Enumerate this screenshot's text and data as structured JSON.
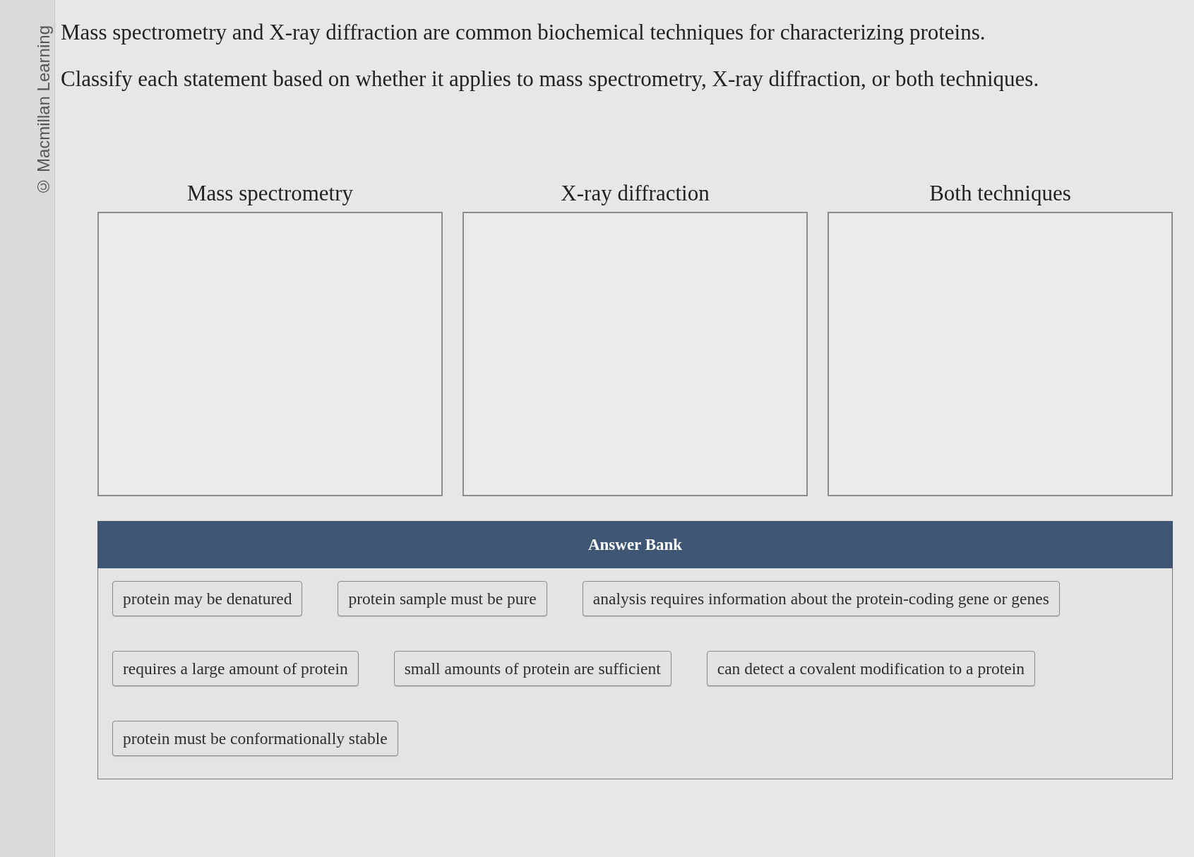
{
  "copyright": "© Macmillan Learning",
  "instructions": [
    "Mass spectrometry and X-ray diffraction are common biochemical techniques for characterizing proteins.",
    "Classify each statement based on whether it applies to mass spectrometry, X-ray diffraction, or both techniques."
  ],
  "categories": [
    {
      "label": "Mass spectrometry"
    },
    {
      "label": "X-ray diffraction"
    },
    {
      "label": "Both techniques"
    }
  ],
  "answer_bank": {
    "title": "Answer Bank",
    "items": [
      "protein may be denatured",
      "protein sample must be pure",
      "analysis requires information about the protein-coding gene or genes",
      "requires a large amount of protein",
      "small amounts of protein are sufficient",
      "can detect a covalent modification to a protein",
      "protein must be conformationally stable"
    ]
  }
}
